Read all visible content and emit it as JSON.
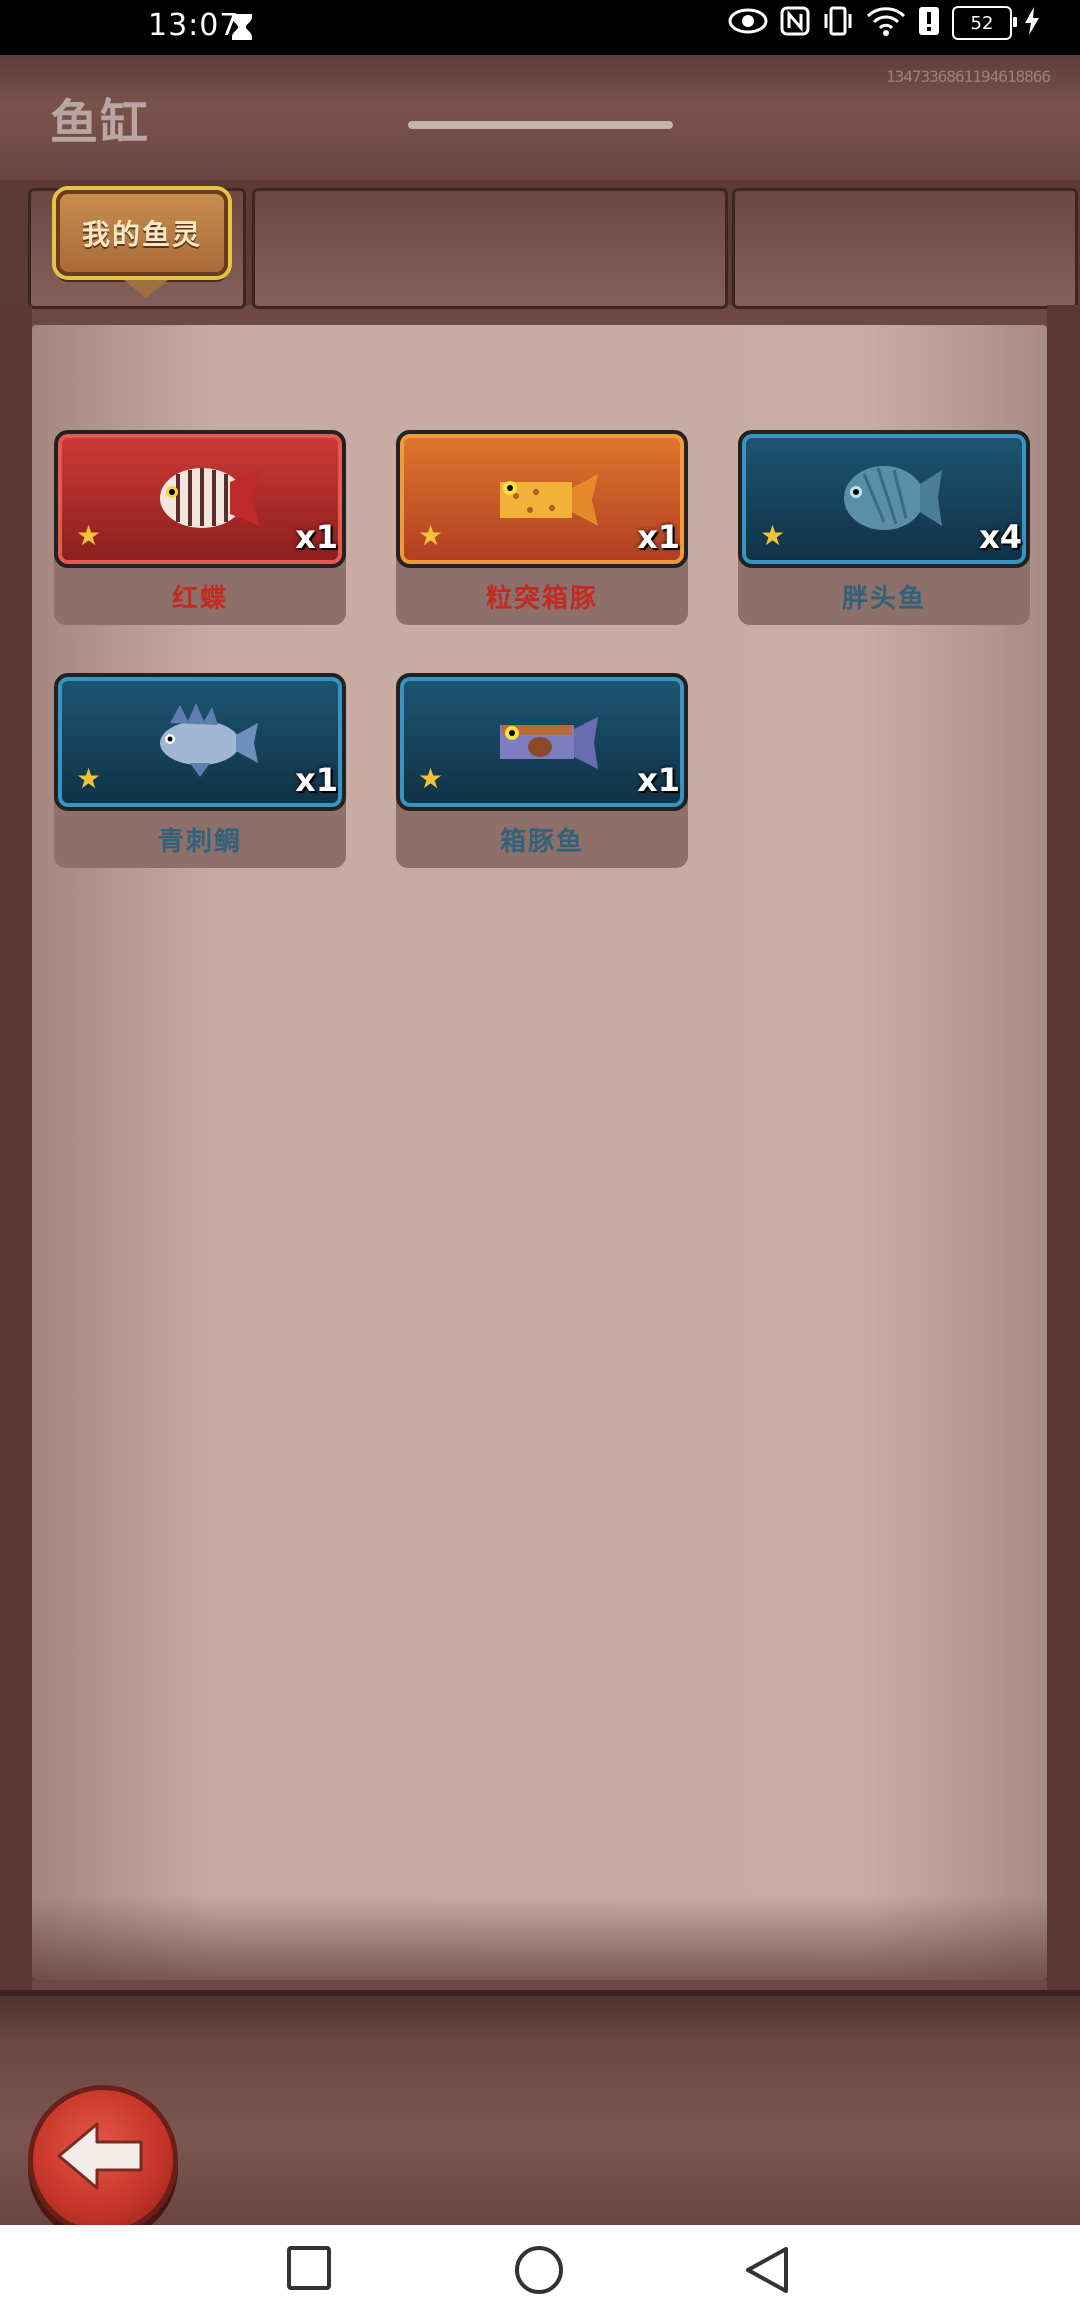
{
  "status_bar": {
    "time": "13:07",
    "battery": "52",
    "icons": [
      "hourglass-icon",
      "eye-icon",
      "nfc-icon",
      "vibrate-icon",
      "wifi-icon",
      "alert-icon",
      "battery-icon",
      "charging-icon"
    ]
  },
  "header": {
    "title": "鱼缸",
    "uid": "1347336861194618866"
  },
  "tabs": {
    "active_label": "我的鱼灵"
  },
  "fish_cards": [
    {
      "name": "红蝶",
      "count": "x1",
      "rarity": "red"
    },
    {
      "name": "粒突箱豚",
      "count": "x1",
      "rarity": "orange"
    },
    {
      "name": "胖头鱼",
      "count": "x4",
      "rarity": "blue"
    },
    {
      "name": "青刺鲷",
      "count": "x1",
      "rarity": "blue"
    },
    {
      "name": "箱豚鱼",
      "count": "x1",
      "rarity": "blue"
    }
  ],
  "colors": {
    "wood": "#6e4943",
    "panel": "#c9ada5",
    "card_red": "#cf3a36",
    "card_orange": "#e0782e",
    "card_blue": "#1d5672",
    "back_button": "#c33327"
  }
}
